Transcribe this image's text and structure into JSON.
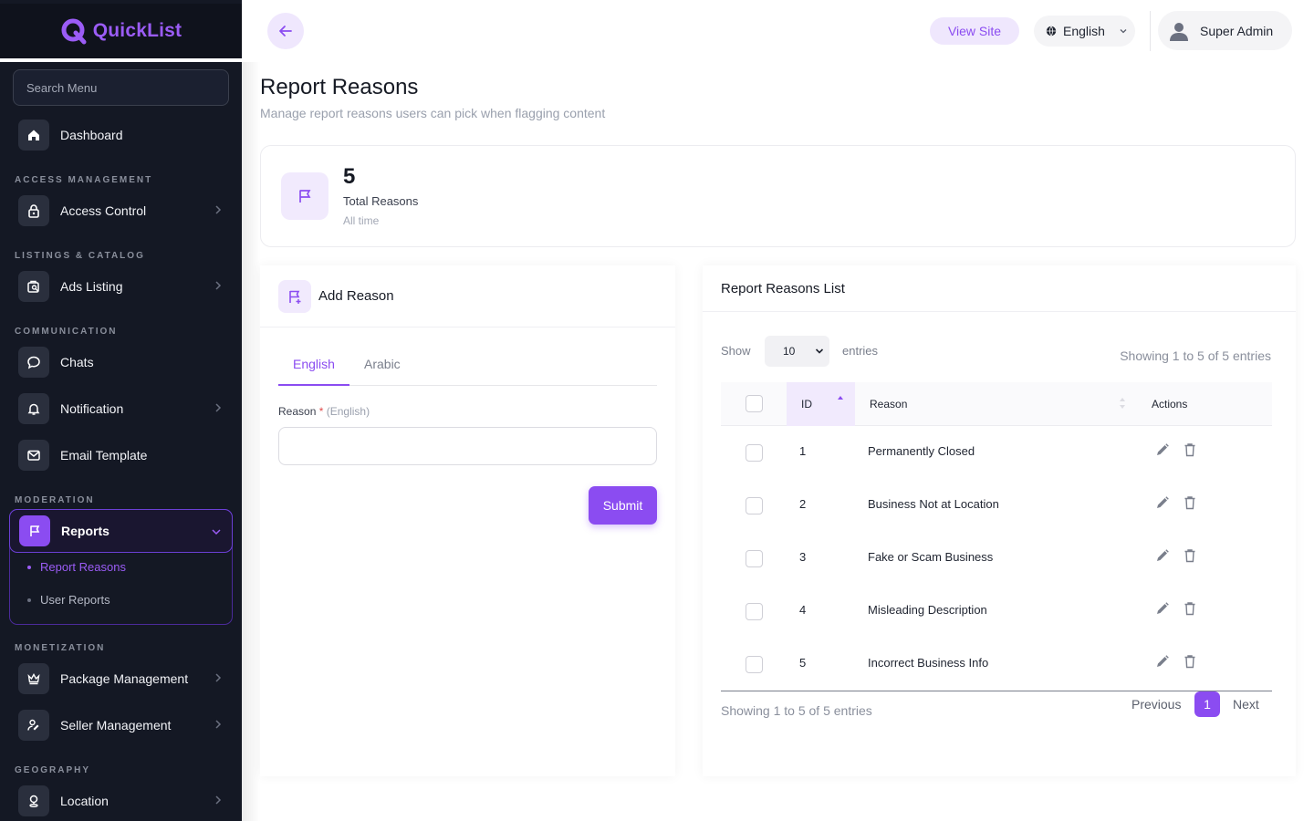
{
  "app": {
    "name": "QuickList"
  },
  "sidebar": {
    "search_placeholder": "Search Menu",
    "dashboard": "Dashboard",
    "sections": {
      "access": "ACCESS MANAGEMENT",
      "listings": "LISTINGS & CATALOG",
      "communication": "COMMUNICATION",
      "moderation": "MODERATION",
      "monetization": "MONETIZATION",
      "geography": "GEOGRAPHY"
    },
    "items": {
      "access_control": "Access Control",
      "ads_listing": "Ads Listing",
      "chats": "Chats",
      "notification": "Notification",
      "email_template": "Email Template",
      "reports": "Reports",
      "package_management": "Package Management",
      "seller_management": "Seller Management",
      "location": "Location"
    },
    "reports_sub": {
      "report_reasons": "Report Reasons",
      "user_reports": "User Reports"
    }
  },
  "topbar": {
    "view_site": "View Site",
    "language": "English",
    "user": "Super Admin"
  },
  "page": {
    "title": "Report Reasons",
    "subtitle": "Manage report reasons users can pick when flagging content"
  },
  "stat": {
    "value": "5",
    "label": "Total Reasons",
    "sub": "All time"
  },
  "add_form": {
    "title": "Add Reason",
    "tabs": [
      "English",
      "Arabic"
    ],
    "field_label": "Reason",
    "required_mark": "*",
    "field_lang": "(English)",
    "submit": "Submit"
  },
  "list": {
    "title": "Report Reasons List",
    "show_label": "Show",
    "entries_value": "10",
    "entries_label": "entries",
    "showing_text": "Showing 1 to 5 of 5 entries",
    "columns": {
      "id": "ID",
      "reason": "Reason",
      "actions": "Actions"
    },
    "rows": [
      {
        "id": "1",
        "reason": "Permanently Closed"
      },
      {
        "id": "2",
        "reason": "Business Not at Location"
      },
      {
        "id": "3",
        "reason": "Fake or Scam Business"
      },
      {
        "id": "4",
        "reason": "Misleading Description"
      },
      {
        "id": "5",
        "reason": "Incorrect Business Info"
      }
    ],
    "pagination": {
      "previous": "Previous",
      "current": "1",
      "next": "Next"
    }
  },
  "colors": {
    "accent": "#8b4cf1",
    "sidebar_bg": "#141824",
    "accent_light": "#f1eafd"
  }
}
